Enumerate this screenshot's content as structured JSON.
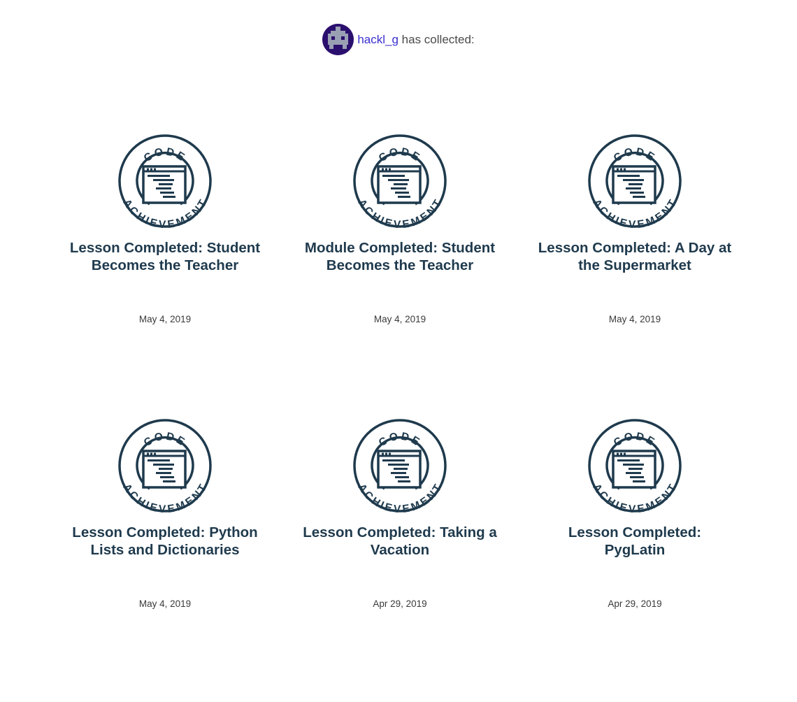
{
  "header": {
    "username": "hackl_g",
    "suffix_text": " has collected:"
  },
  "badge_icon": {
    "top_text": "CODE",
    "bottom_text": "ACHIEVEMENT",
    "color": "#1f3a4d"
  },
  "achievements": [
    {
      "title": "Lesson Completed: Student Becomes the Teacher",
      "date": "May 4, 2019"
    },
    {
      "title": "Module Completed: Student Becomes the Teacher",
      "date": "May 4, 2019"
    },
    {
      "title": "Lesson Completed: A Day at the Supermarket",
      "date": "May 4, 2019"
    },
    {
      "title": "Lesson Completed: Python Lists and Dictionaries",
      "date": "May 4, 2019"
    },
    {
      "title": "Lesson Completed: Taking a Vacation",
      "date": "Apr 29, 2019"
    },
    {
      "title": "Lesson Completed: PygLatin",
      "date": "Apr 29, 2019"
    }
  ]
}
